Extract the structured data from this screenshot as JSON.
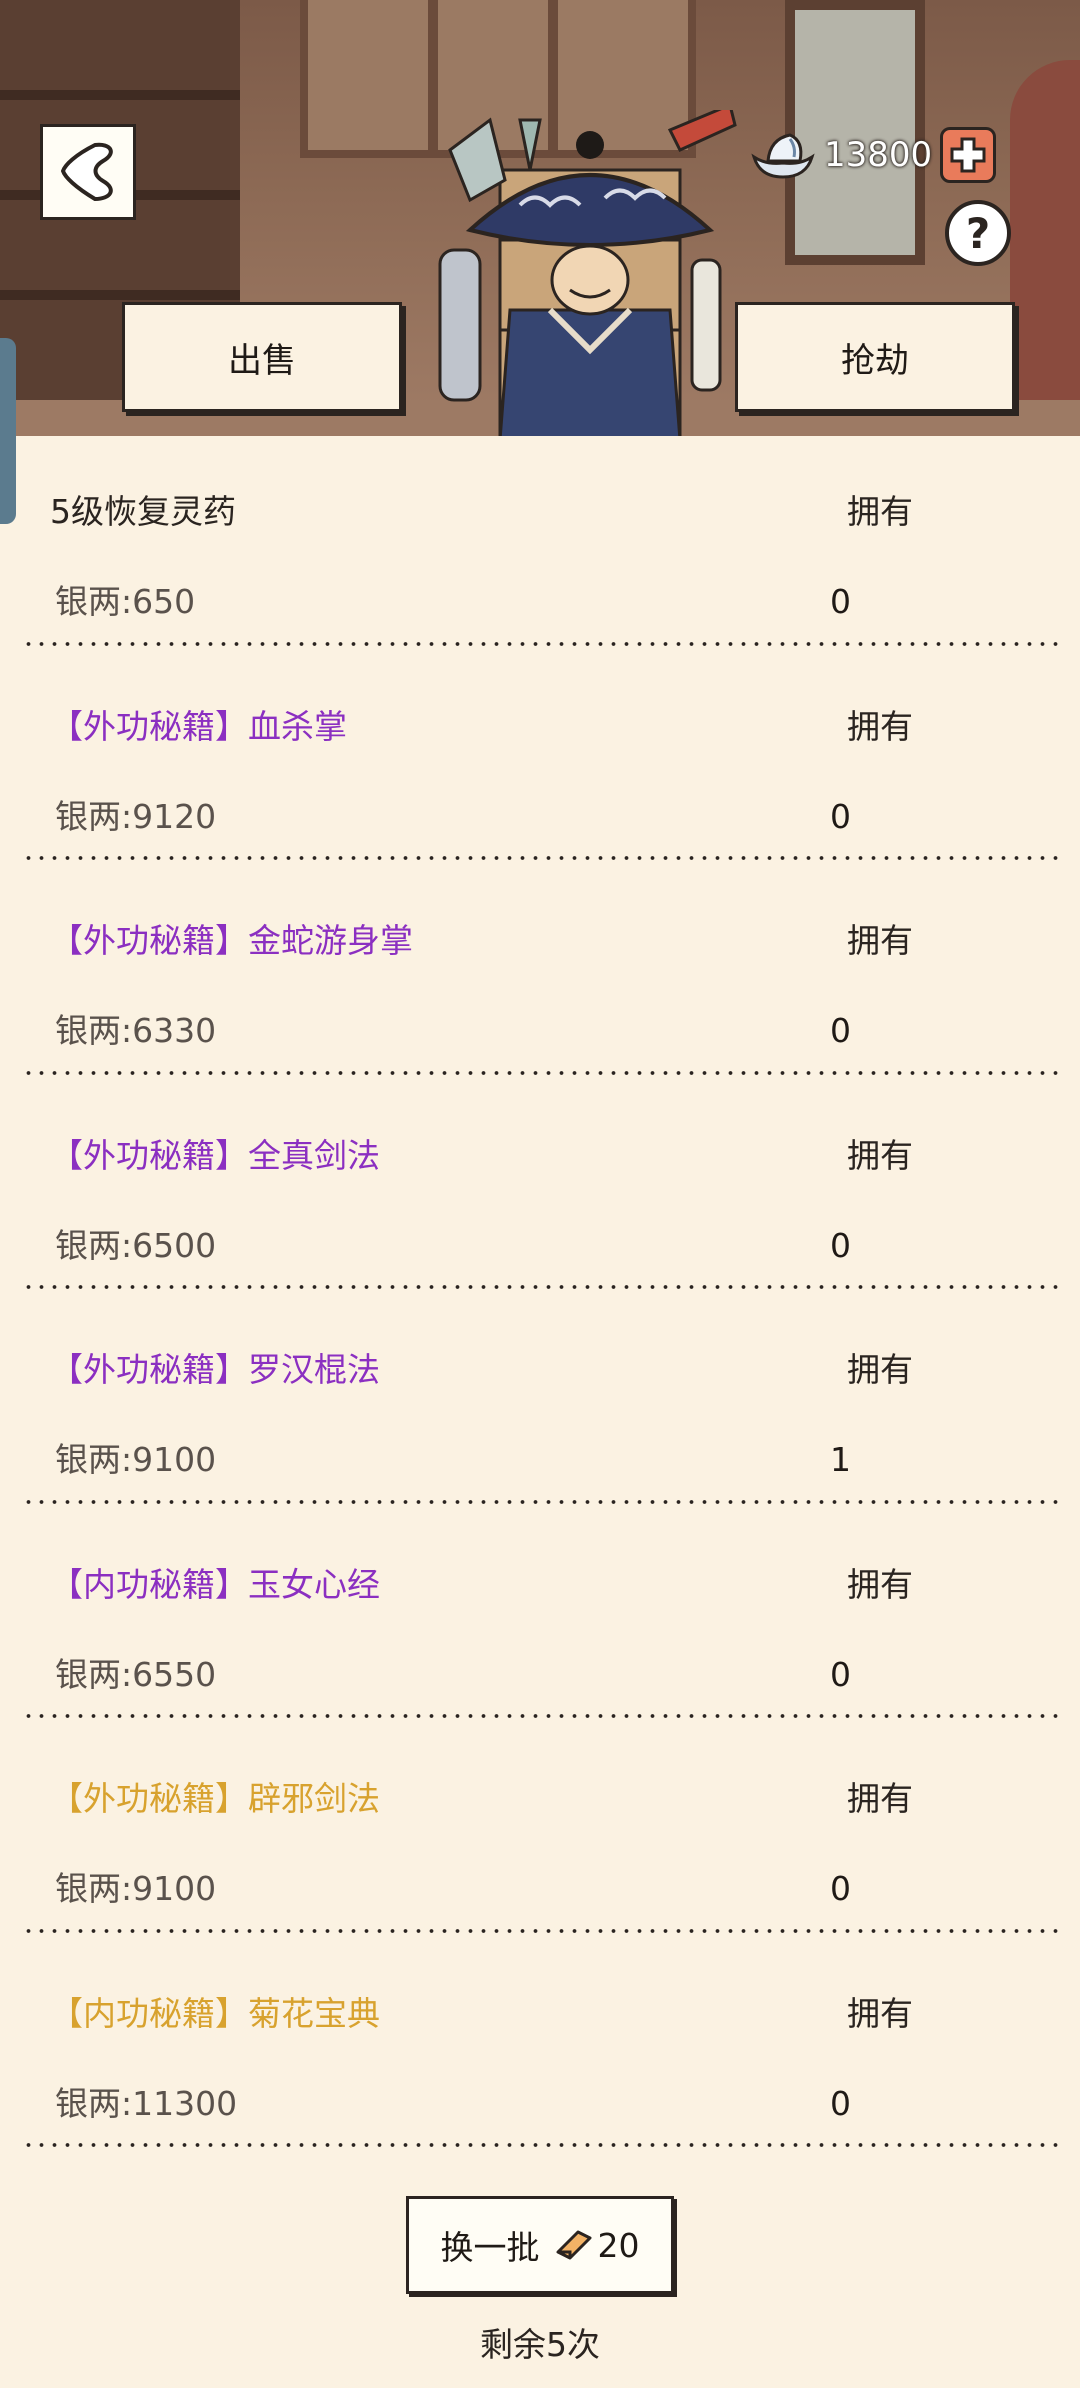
{
  "header": {
    "silver_amount": "13800",
    "sell_label": "出售",
    "rob_label": "抢劫",
    "help_symbol": "?"
  },
  "items": [
    {
      "name": "5级恢复灵药",
      "name_color": "plain",
      "price": "银两:650",
      "owned_label": "拥有",
      "owned_count": "0"
    },
    {
      "name": "【外功秘籍】血杀掌",
      "name_color": "purple",
      "price": "银两:9120",
      "owned_label": "拥有",
      "owned_count": "0"
    },
    {
      "name": "【外功秘籍】金蛇游身掌",
      "name_color": "purple",
      "price": "银两:6330",
      "owned_label": "拥有",
      "owned_count": "0"
    },
    {
      "name": "【外功秘籍】全真剑法",
      "name_color": "purple",
      "price": "银两:6500",
      "owned_label": "拥有",
      "owned_count": "0"
    },
    {
      "name": "【外功秘籍】罗汉棍法",
      "name_color": "purple",
      "price": "银两:9100",
      "owned_label": "拥有",
      "owned_count": "1"
    },
    {
      "name": "【内功秘籍】玉女心经",
      "name_color": "purple",
      "price": "银两:6550",
      "owned_label": "拥有",
      "owned_count": "0"
    },
    {
      "name": "【外功秘籍】辟邪剑法",
      "name_color": "gold",
      "price": "银两:9100",
      "owned_label": "拥有",
      "owned_count": "0"
    },
    {
      "name": "【内功秘籍】菊花宝典",
      "name_color": "gold",
      "price": "银两:11300",
      "owned_label": "拥有",
      "owned_count": "0"
    }
  ],
  "footer": {
    "refresh_label": "换一批",
    "refresh_cost": "20",
    "remaining_text": "剩余5次"
  },
  "colors": {
    "background": "#fbf2e2",
    "purple": "#8b2fc1",
    "gold": "#d8a22e",
    "plus_button": "#e97b5b"
  },
  "icons": {
    "back": "back-arrow-icon",
    "silver": "silver-ingot-icon",
    "plus": "plus-icon",
    "help": "help-icon",
    "refresh_cost": "token-icon"
  }
}
